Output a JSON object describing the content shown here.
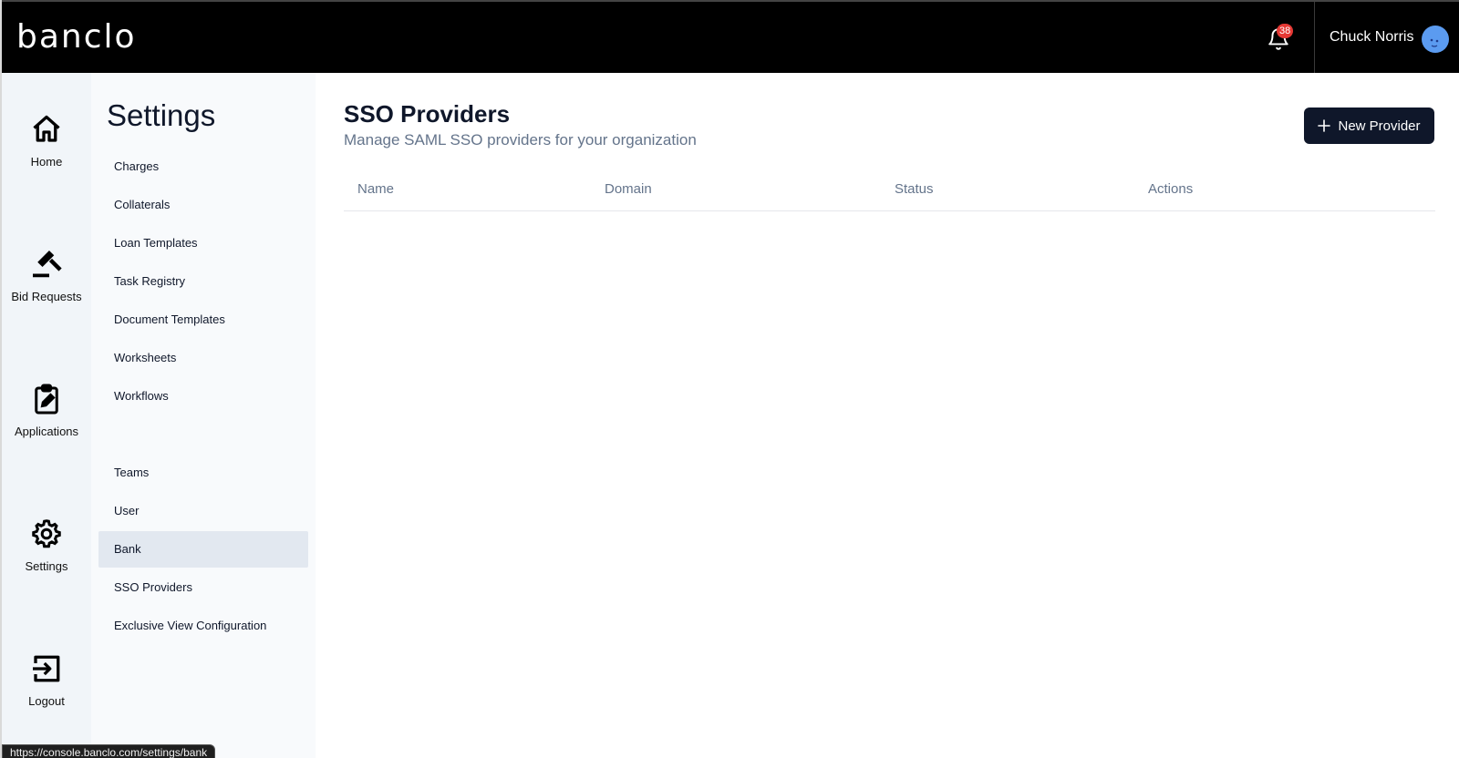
{
  "brand": {
    "logo_text": "banclo"
  },
  "header": {
    "notification_count": "38",
    "user_name": "Chuck Norris",
    "avatar_color": "#5b9bf0"
  },
  "rail": {
    "items": [
      {
        "label": "Home",
        "icon": "home-icon"
      },
      {
        "label": "Bid Requests",
        "icon": "gavel-icon"
      },
      {
        "label": "Applications",
        "icon": "clipboard-edit-icon"
      },
      {
        "label": "Settings",
        "icon": "gear-icon"
      },
      {
        "label": "Logout",
        "icon": "logout-icon"
      }
    ]
  },
  "settings": {
    "title": "Settings",
    "items": [
      {
        "label": "Charges"
      },
      {
        "label": "Collaterals"
      },
      {
        "label": "Loan Templates"
      },
      {
        "label": "Task Registry"
      },
      {
        "label": "Document Templates"
      },
      {
        "label": "Worksheets"
      },
      {
        "label": "Workflows"
      },
      {
        "label": "Teams"
      },
      {
        "label": "User"
      },
      {
        "label": "Bank",
        "active": true
      },
      {
        "label": "SSO Providers"
      },
      {
        "label": "Exclusive View Configuration"
      }
    ]
  },
  "main": {
    "title": "SSO Providers",
    "subtitle": "Manage SAML SSO providers for your organization",
    "new_button_label": "New Provider",
    "table": {
      "columns": [
        "Name",
        "Domain",
        "Status",
        "Actions"
      ],
      "rows": []
    }
  },
  "status_bar": {
    "url": "https://console.banclo.com/settings/bank"
  },
  "colors": {
    "topbar_bg": "#000000",
    "primary_button": "#0f172a",
    "active_item_bg": "#e2e8f0",
    "badge": "#e53935"
  }
}
